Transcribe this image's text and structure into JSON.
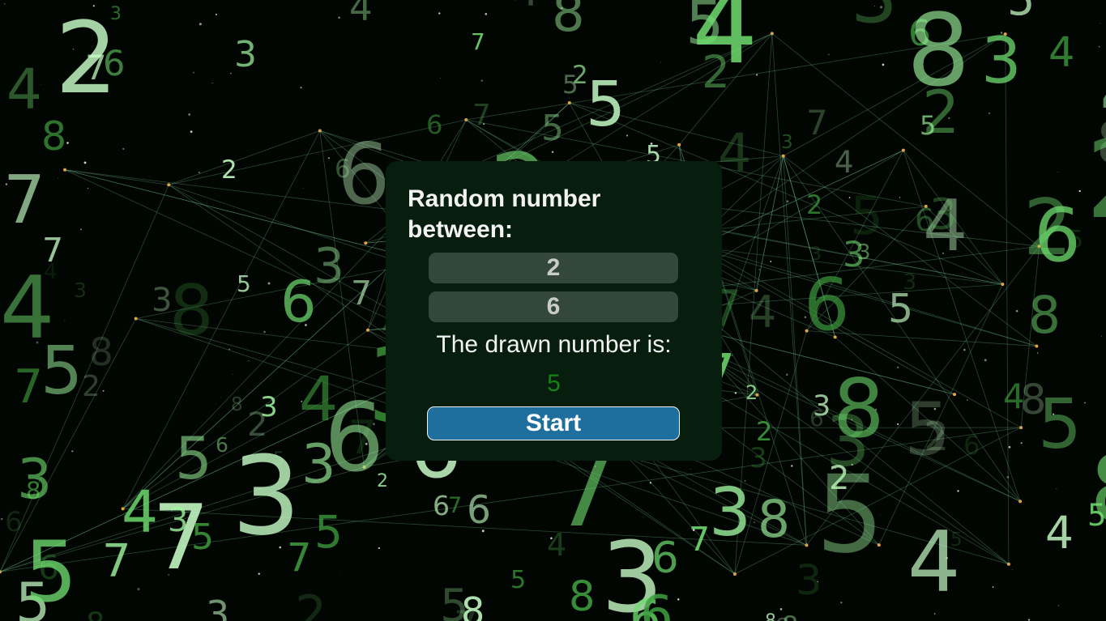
{
  "background": {
    "description": "matrix-digits",
    "colors": [
      "#6fdc6f",
      "#9ff59f",
      "#3f9f3f",
      "#c8ffc8"
    ]
  },
  "form": {
    "heading": "Random number between:",
    "min_value": "2",
    "max_value": "6",
    "result_label": "The drawn number is:",
    "result_value": "5",
    "start_label": "Start"
  },
  "colors": {
    "card": "#071d0d",
    "input_bg": "#33473a",
    "result": "#128312",
    "button": "#1f6f9e"
  }
}
